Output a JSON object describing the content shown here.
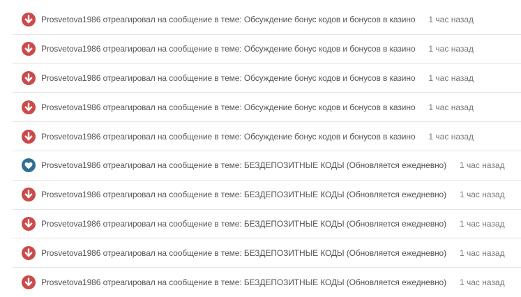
{
  "activity": {
    "items": [
      {
        "icon": "downvote-icon",
        "user": "Prosvetova1986",
        "action": "отреагировал на сообщение в теме:",
        "topic": "Обсуждение бонус кодов и бонусов в казино",
        "time": "1 час назад"
      },
      {
        "icon": "downvote-icon",
        "user": "Prosvetova1986",
        "action": "отреагировал на сообщение в теме:",
        "topic": "Обсуждение бонус кодов и бонусов в казино",
        "time": "1 час назад"
      },
      {
        "icon": "downvote-icon",
        "user": "Prosvetova1986",
        "action": "отреагировал на сообщение в теме:",
        "topic": "Обсуждение бонус кодов и бонусов в казино",
        "time": "1 час назад"
      },
      {
        "icon": "downvote-icon",
        "user": "Prosvetova1986",
        "action": "отреагировал на сообщение в теме:",
        "topic": "Обсуждение бонус кодов и бонусов в казино",
        "time": "1 час назад"
      },
      {
        "icon": "downvote-icon",
        "user": "Prosvetova1986",
        "action": "отреагировал на сообщение в теме:",
        "topic": "Обсуждение бонус кодов и бонусов в казино",
        "time": "1 час назад"
      },
      {
        "icon": "heart-icon",
        "user": "Prosvetova1986",
        "action": "отреагировал на сообщение в теме:",
        "topic": "БЕЗДЕПОЗИТНЫЕ КОДЫ (Обновляется ежедневно)",
        "time": "1 час назад"
      },
      {
        "icon": "downvote-icon",
        "user": "Prosvetova1986",
        "action": "отреагировал на сообщение в теме:",
        "topic": "БЕЗДЕПОЗИТНЫЕ КОДЫ (Обновляется ежедневно)",
        "time": "1 час назад"
      },
      {
        "icon": "downvote-icon",
        "user": "Prosvetova1986",
        "action": "отреагировал на сообщение в теме:",
        "topic": "БЕЗДЕПОЗИТНЫЕ КОДЫ (Обновляется ежедневно)",
        "time": "1 час назад"
      },
      {
        "icon": "downvote-icon",
        "user": "Prosvetova1986",
        "action": "отреагировал на сообщение в теме:",
        "topic": "БЕЗДЕПОЗИТНЫЕ КОДЫ (Обновляется ежедневно)",
        "time": "1 час назад"
      },
      {
        "icon": "downvote-icon",
        "user": "Prosvetova1986",
        "action": "отреагировал на сообщение в теме:",
        "topic": "БЕЗДЕПОЗИТНЫЕ КОДЫ (Обновляется ежедневно)",
        "time": "1 час назад"
      }
    ]
  },
  "colors": {
    "downvote": "#cb4a4a",
    "heart": "#2f6f96"
  }
}
